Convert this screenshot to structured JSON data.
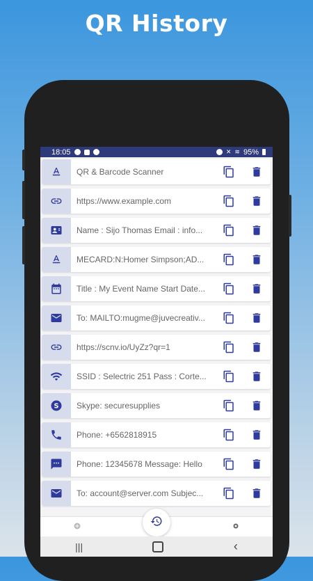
{
  "headline": "QR History",
  "status_bar": {
    "time": "18:05",
    "battery": "95%"
  },
  "items": [
    {
      "icon": "text-icon",
      "text": "QR & Barcode Scanner"
    },
    {
      "icon": "link-icon",
      "text": "https://www.example.com"
    },
    {
      "icon": "contact-card-icon",
      "text": "Name : Sijo Thomas Email : info..."
    },
    {
      "icon": "text-icon",
      "text": "MECARD:N:Homer Simpson;AD..."
    },
    {
      "icon": "calendar-icon",
      "text": "Title : My Event Name Start Date..."
    },
    {
      "icon": "email-icon",
      "text": "To: MAILTO:mugme@juvecreativ..."
    },
    {
      "icon": "link-icon",
      "text": "https://scnv.io/UyZz?qr=1"
    },
    {
      "icon": "wifi-icon",
      "text": "SSID : Selectric 251 Pass : Corte..."
    },
    {
      "icon": "skype-icon",
      "text": "Skype: securesupplies"
    },
    {
      "icon": "phone-icon",
      "text": "Phone: +6562818915"
    },
    {
      "icon": "sms-icon",
      "text": "Phone: 12345678 Message: Hello"
    },
    {
      "icon": "email-icon",
      "text": "To: account@server.com Subjec..."
    }
  ],
  "actions": {
    "copy_icon": "copy-icon",
    "delete_icon": "delete-icon"
  },
  "bottom_nav": [
    "scan-icon",
    "history-icon",
    "settings-icon"
  ],
  "colors": {
    "accent": "#2e3a9e",
    "type_bg": "#d7dced",
    "statusbar": "#2e3a7a"
  }
}
